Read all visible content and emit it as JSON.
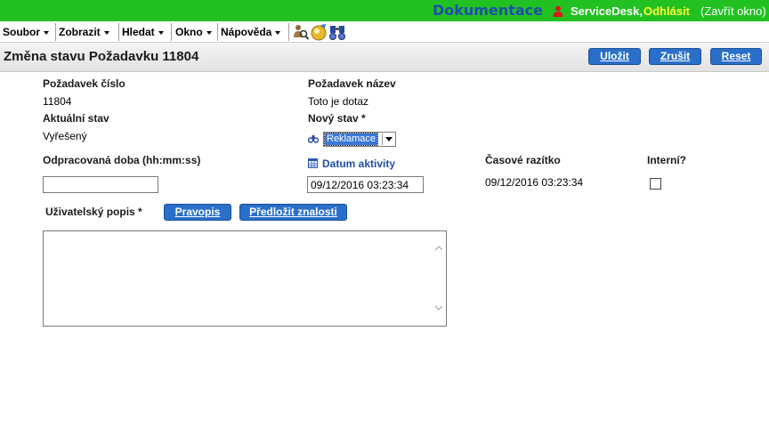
{
  "header": {
    "doc_link": "Dokumentace",
    "user": "ServiceDesk,",
    "logout": "Odhlásit",
    "close_window": "(Zavřít okno)"
  },
  "menu": [
    {
      "label": "Soubor"
    },
    {
      "label": "Zobrazit"
    },
    {
      "label": "Hledat"
    },
    {
      "label": "Okno"
    },
    {
      "label": "Nápověda"
    }
  ],
  "toolbar_icons": [
    "search-people-icon",
    "knowledge-icon",
    "binoculars-icon"
  ],
  "title": "Změna stavu Požadavku 11804",
  "buttons": {
    "save": "Uložit",
    "cancel": "Zrušit",
    "reset": "Reset",
    "spell": "Pravopis",
    "submit_knowledge": "Předložit znalosti"
  },
  "form": {
    "request_number_label": "Požadavek číslo",
    "request_number": "11804",
    "request_name_label": "Požadavek název",
    "request_name": "Toto je dotaz",
    "current_status_label": "Aktuální stav",
    "current_status": "Vyřešený",
    "new_status_label": "Nový stav *",
    "new_status": "Reklamace",
    "worked_time_label": "Odpracovaná doba (hh:mm:ss)",
    "worked_time_value": "",
    "activity_date_label": "Datum aktivity",
    "activity_date_value": "09/12/2016 03:23:34",
    "timestamp_label": "Časové razítko",
    "timestamp_value": "09/12/2016 03:23:34",
    "internal_label": "Interní?",
    "internal_checked": false,
    "user_description_label": "Uživatelský popis *",
    "user_description_value": ""
  },
  "colors": {
    "topbar": "#22c122",
    "doc_link": "#1f4ea8",
    "logout": "#ffff33",
    "button": "#2a6fc9"
  }
}
